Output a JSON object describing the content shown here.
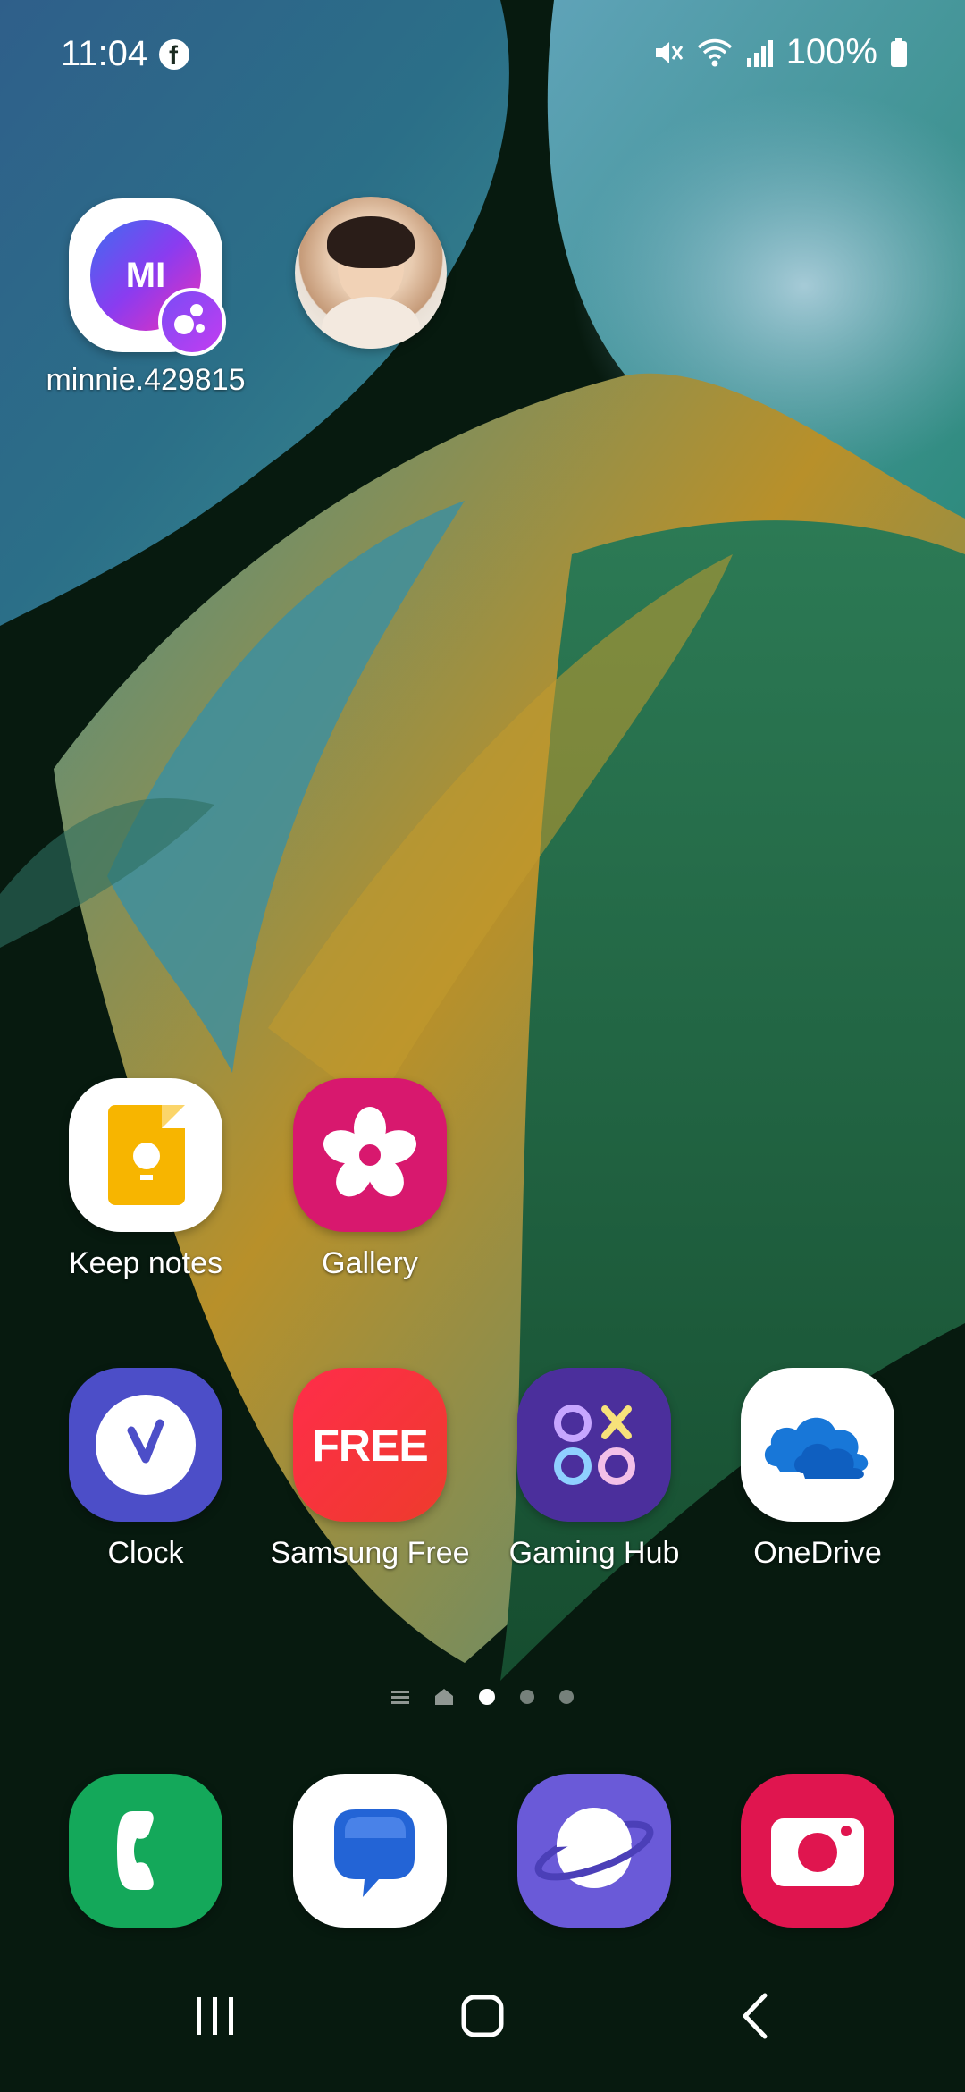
{
  "status_bar": {
    "time": "11:04",
    "battery": "100%",
    "icons": [
      "facebook-icon",
      "mute-icon",
      "wifi-icon",
      "signal-icon",
      "battery-icon"
    ]
  },
  "top_row": {
    "messenger_app": {
      "icon_text": "MI",
      "label": "minnie.429815"
    },
    "contact": {
      "name": ""
    }
  },
  "home_apps": [
    {
      "label": "Keep notes"
    },
    {
      "label": "Gallery"
    },
    {
      "label": "Clock"
    },
    {
      "label": "Samsung Free",
      "icon_text": "FREE"
    },
    {
      "label": "Gaming Hub"
    },
    {
      "label": "OneDrive"
    }
  ],
  "page_indicator": {
    "pages": 4,
    "current_page": 1
  },
  "dock": [
    "phone-icon",
    "messages-icon",
    "internet-icon",
    "camera-icon"
  ],
  "navigation": [
    "recent-apps-button",
    "home-button",
    "back-button"
  ],
  "colors": {
    "keep_notes_yellow": "#f7b500",
    "gallery_pink": "#d8186e",
    "clock_indigo": "#4c4ec8",
    "samsung_free_red": "#ef2d3c",
    "gaming_hub_purple": "#4b2f9c",
    "onedrive_blue": "#1877d8",
    "phone_green": "#14a85a",
    "messages_blue": "#2364d6",
    "internet_violet": "#6a5ad8",
    "camera_red": "#e0154f"
  }
}
